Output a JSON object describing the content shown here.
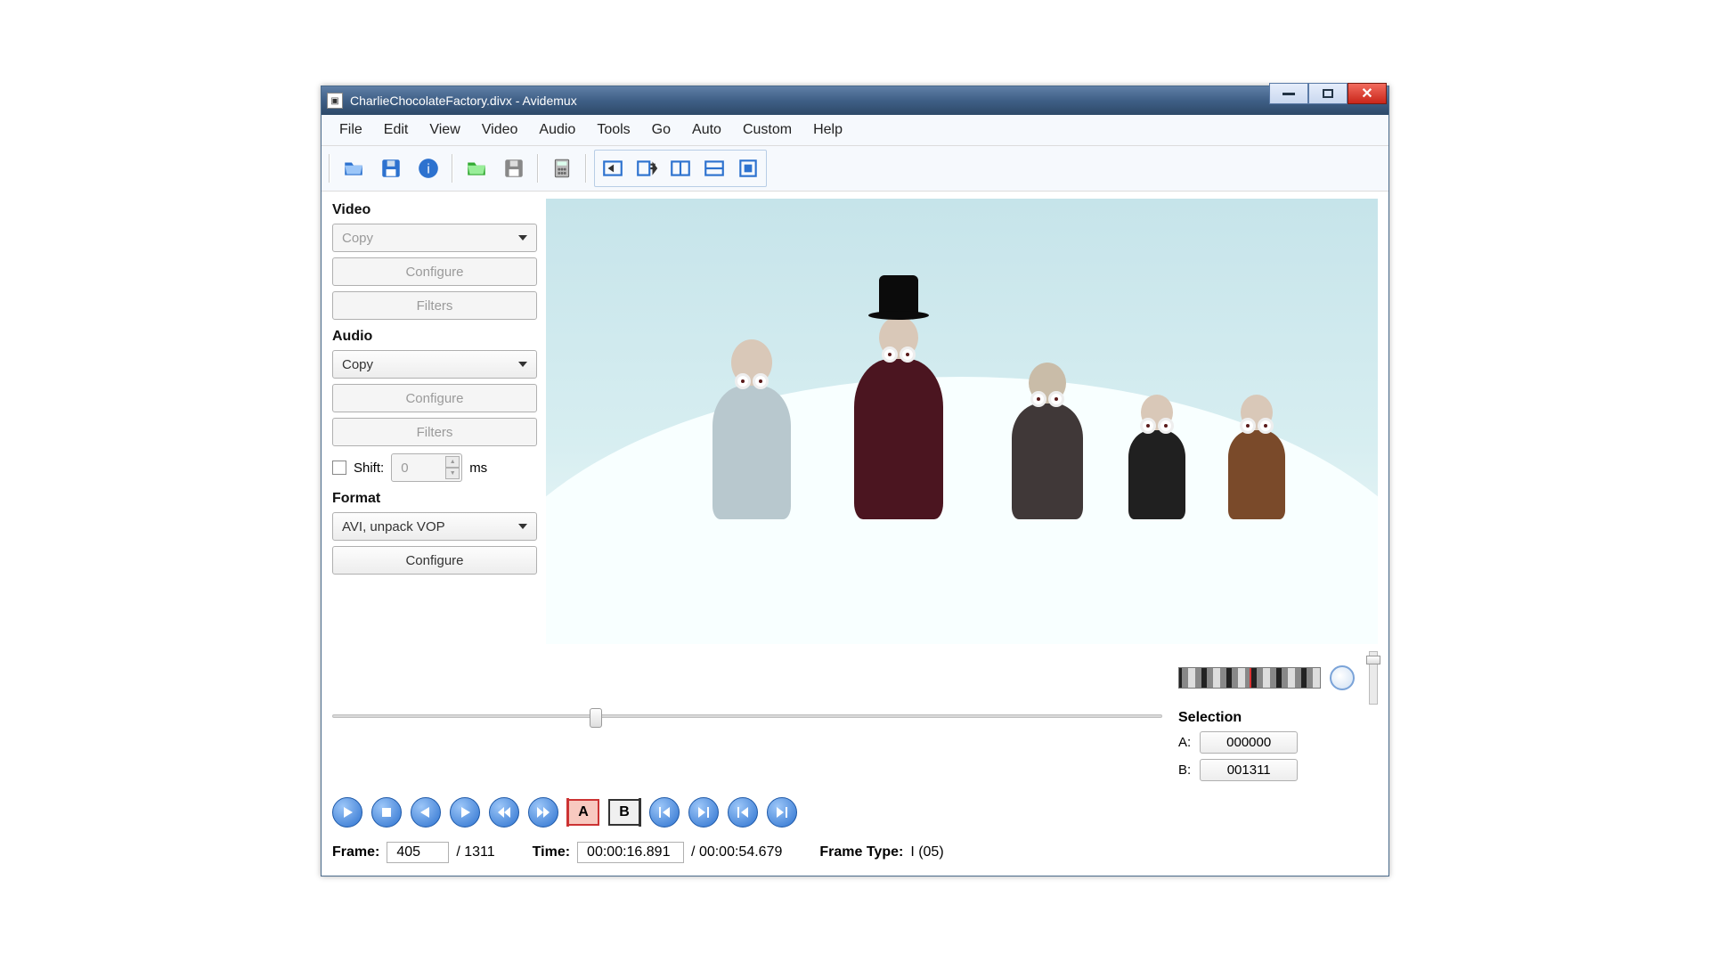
{
  "window": {
    "title": "CharlieChocolateFactory.divx - Avidemux"
  },
  "menu": [
    "File",
    "Edit",
    "View",
    "Video",
    "Audio",
    "Tools",
    "Go",
    "Auto",
    "Custom",
    "Help"
  ],
  "toolbar_icons": [
    "open",
    "save",
    "info",
    "open-folder",
    "save-as",
    "calculator",
    "insert-clip",
    "append-clip",
    "split-h",
    "split-v",
    "crop"
  ],
  "sidebar": {
    "video": {
      "label": "Video",
      "codec": "Copy",
      "configure": "Configure",
      "filters": "Filters"
    },
    "audio": {
      "label": "Audio",
      "codec": "Copy",
      "configure": "Configure",
      "filters": "Filters",
      "shift_label": "Shift:",
      "shift_value": "0",
      "shift_unit": "ms"
    },
    "format": {
      "label": "Format",
      "container": "AVI, unpack VOP",
      "configure": "Configure"
    }
  },
  "seek": {
    "position_pct": 31
  },
  "selection": {
    "label": "Selection",
    "a_label": "A:",
    "a_value": "000000",
    "b_label": "B:",
    "b_value": "001311"
  },
  "transport": {
    "buttons": [
      {
        "name": "play",
        "shape": "play"
      },
      {
        "name": "stop",
        "shape": "stop"
      },
      {
        "name": "prev-frame",
        "shape": "arrow-left"
      },
      {
        "name": "next-frame",
        "shape": "arrow-right"
      },
      {
        "name": "fast-back",
        "shape": "rewind"
      },
      {
        "name": "fast-fwd",
        "shape": "fastfwd"
      }
    ],
    "mark_a": "A",
    "mark_b": "B",
    "goto": [
      {
        "name": "goto-mark-a",
        "shape": "skip-back-bar"
      },
      {
        "name": "goto-mark-b",
        "shape": "skip-fwd-bar"
      },
      {
        "name": "first-frame",
        "shape": "skip-back"
      },
      {
        "name": "last-frame",
        "shape": "skip-fwd"
      }
    ]
  },
  "status": {
    "frame_label": "Frame:",
    "frame_value": "405",
    "frame_total": "/ 1311",
    "time_label": "Time:",
    "time_value": "00:00:16.891",
    "time_total": "/ 00:00:54.679",
    "type_label": "Frame Type:",
    "type_value": "I (05)"
  }
}
